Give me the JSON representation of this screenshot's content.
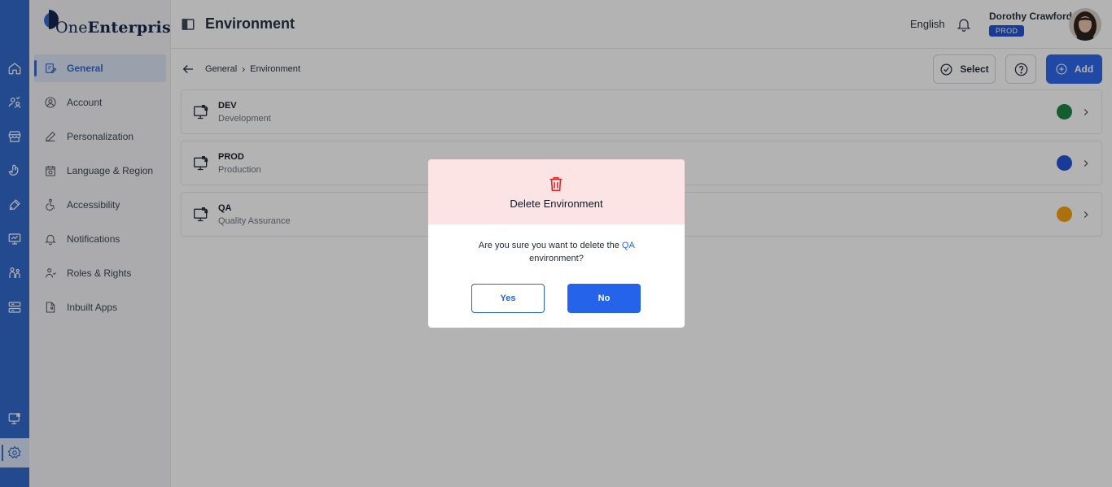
{
  "app": {
    "brand_prefix": "One",
    "brand_suffix": "Enterprise"
  },
  "rail": {
    "items": [
      "home-icon",
      "users-icon",
      "store-icon",
      "touch-icon",
      "tools-icon",
      "monitor-chart-icon",
      "people-icon",
      "server-icon"
    ],
    "bottom_items": [
      "environment-monitor-icon",
      "settings-icon"
    ],
    "active": "settings-icon"
  },
  "sidebar": {
    "items": [
      {
        "label": "General",
        "icon": "general-edit-icon",
        "active": true
      },
      {
        "label": "Account",
        "icon": "account-icon"
      },
      {
        "label": "Personalization",
        "icon": "pencil-icon"
      },
      {
        "label": "Language & Region",
        "icon": "language-icon"
      },
      {
        "label": "Accessibility",
        "icon": "accessibility-icon"
      },
      {
        "label": "Notifications",
        "icon": "bell-icon"
      },
      {
        "label": "Roles & Rights",
        "icon": "roles-icon"
      },
      {
        "label": "Inbuilt Apps",
        "icon": "apps-icon"
      }
    ]
  },
  "header": {
    "title": "Environment",
    "language": "English",
    "user_name": "Dorothy Crawford",
    "env_badge": "PROD"
  },
  "toolbar": {
    "breadcrumb": [
      "General",
      "Environment"
    ],
    "select_label": "Select",
    "add_label": "Add"
  },
  "environments": [
    {
      "code": "DEV",
      "description": "Development",
      "color": "#15803d"
    },
    {
      "code": "PROD",
      "description": "Production",
      "color": "#1d4ed8"
    },
    {
      "code": "QA",
      "description": "Quality Assurance",
      "color": "#f59e0b"
    }
  ],
  "modal": {
    "title": "Delete Environment",
    "message_before": "Are you sure you want to delete the ",
    "highlight": "QA",
    "message_after": " environment?",
    "yes_label": "Yes",
    "no_label": "No"
  },
  "colors": {
    "accent": "#2563eb",
    "rail": "#2c63c9",
    "danger": "#e02424",
    "modal_header_bg": "#fde4e4"
  }
}
